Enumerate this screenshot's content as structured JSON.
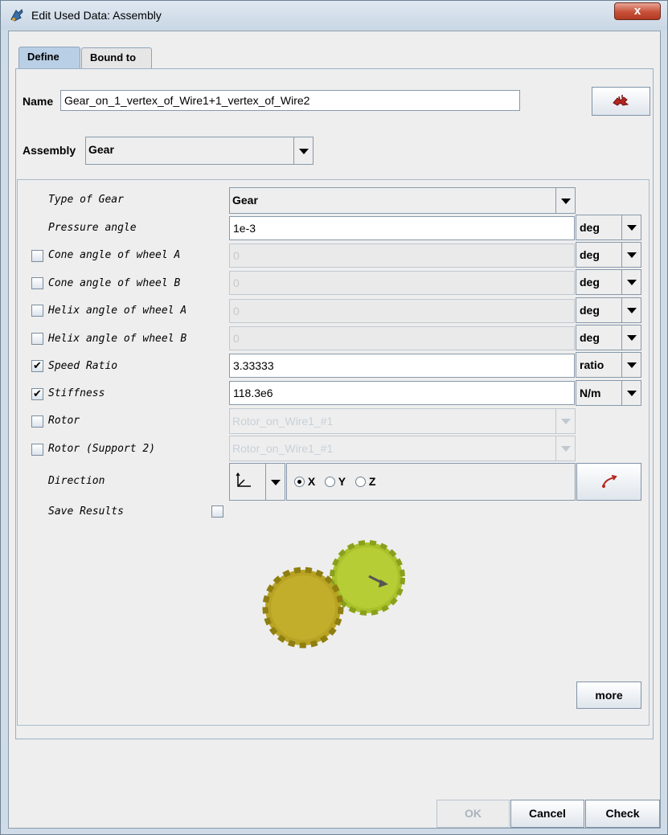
{
  "window": {
    "title": "Edit Used Data: Assembly",
    "close_glyph": "x"
  },
  "tabs": [
    {
      "label": "Define",
      "selected": true
    },
    {
      "label": "Bound to",
      "selected": false
    }
  ],
  "name_field": {
    "label": "Name",
    "value": "Gear_on_1_vertex_of_Wire1+1_vertex_of_Wire2",
    "pick_button_icon": "pick-icon"
  },
  "assembly": {
    "label": "Assembly",
    "selected": "Gear"
  },
  "params": {
    "type_of_gear": {
      "label": "Type of Gear",
      "value": "Gear"
    },
    "pressure_angle": {
      "label": "Pressure angle",
      "value": "1e-3",
      "unit": "deg"
    },
    "cone_a": {
      "label": "Cone angle of wheel A",
      "value": "0",
      "unit": "deg",
      "checked": false
    },
    "cone_b": {
      "label": "Cone angle of wheel B",
      "value": "0",
      "unit": "deg",
      "checked": false
    },
    "helix_a": {
      "label": "Helix angle of wheel A",
      "value": "0",
      "unit": "deg",
      "checked": false
    },
    "helix_b": {
      "label": "Helix angle of wheel B",
      "value": "0",
      "unit": "deg",
      "checked": false
    },
    "speed_ratio": {
      "label": "Speed Ratio",
      "value": "3.33333",
      "unit": "ratio",
      "checked": true
    },
    "stiffness": {
      "label": "Stiffness",
      "value": "118.3e6",
      "unit": "N/m",
      "checked": true
    },
    "rotor": {
      "label": "Rotor",
      "value": "Rotor_on_Wire1_#1",
      "checked": false
    },
    "rotor_support2": {
      "label": "Rotor (Support 2)",
      "value": "Rotor_on_Wire1_#1",
      "checked": false
    },
    "direction": {
      "label": "Direction",
      "options": [
        "X",
        "Y",
        "Z"
      ],
      "selected": "X"
    },
    "save_results": {
      "label": "Save Results",
      "checked": false
    }
  },
  "check_glyph": "✔",
  "more_button": "more",
  "footer": {
    "ok": "OK",
    "cancel": "Cancel",
    "check": "Check"
  },
  "colors": {
    "gear_left": "#b8a324",
    "gear_right": "#a9c12b"
  }
}
